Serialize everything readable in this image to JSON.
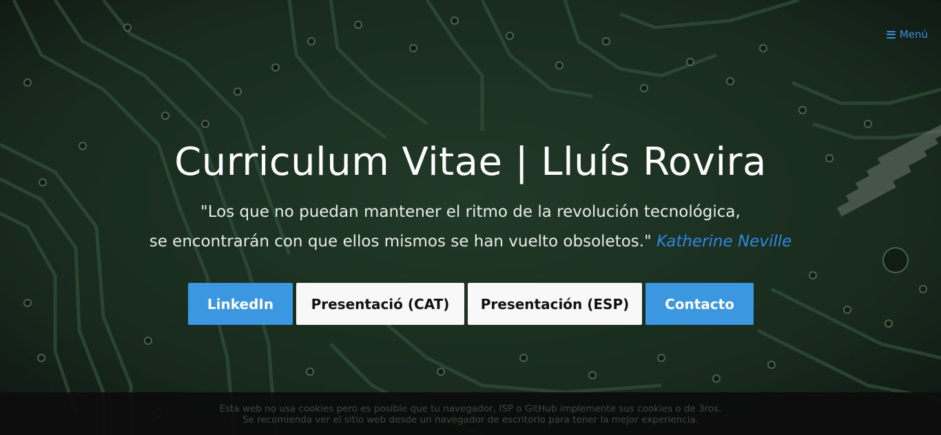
{
  "menu": {
    "label": "Menú",
    "icon": "hamburger-icon",
    "color": "#3a8fd9"
  },
  "hero": {
    "title": "Curriculum Vitae | Lluís Rovira",
    "quote_line1": "\"Los que no puedan mantener el ritmo de la revolución tecnológica,",
    "quote_line2": "se encontrarán con que ellos mismos se han vuelto obsoletos.\"",
    "quote_author": "Katherine Neville",
    "author_color": "#2e88e0"
  },
  "buttons": [
    {
      "label": "LinkedIn",
      "style": "primary"
    },
    {
      "label": "Presentació (CAT)",
      "style": "light"
    },
    {
      "label": "Presentación (ESP)",
      "style": "light"
    },
    {
      "label": "Contacto",
      "style": "primary"
    }
  ],
  "colors": {
    "primary_button": "#3a97e0",
    "light_button": "#f8f8f8",
    "background": "#1d3324"
  },
  "footer": {
    "line1": "Esta web no usa cookies pero es posible que tu navegador, ISP o GitHub implemente sus cookies o de 3ros.",
    "line2": "Se recomienda ver el sitio web desde un navegador de escritorio para tener la mejor experiencia."
  }
}
